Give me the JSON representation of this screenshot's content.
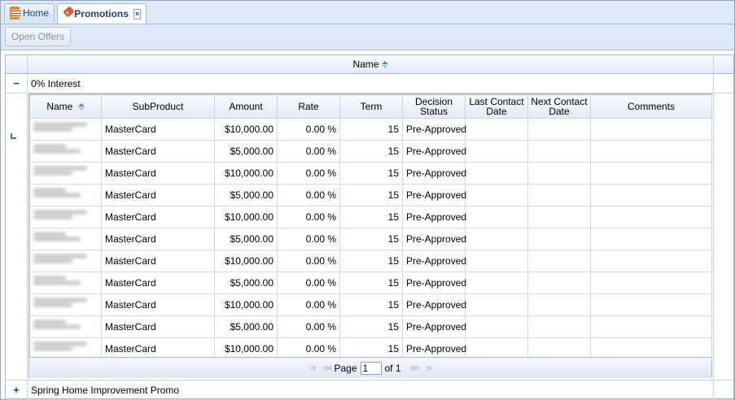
{
  "tabs": [
    {
      "label": "Home",
      "icon": "calendar-icon"
    },
    {
      "label": "Promotions",
      "icon": "tag-icon",
      "close": "×"
    }
  ],
  "toolbar": {
    "open_offers": "Open Offers"
  },
  "outer_grid": {
    "header": "Name",
    "groups": [
      {
        "toggle": "−",
        "label": "0% Interest",
        "expanded": true
      },
      {
        "toggle": "+",
        "label": "Spring Home Improvement Promo",
        "expanded": false
      }
    ]
  },
  "inner_grid": {
    "columns": [
      "Name",
      "SubProduct",
      "Amount",
      "Rate",
      "Term",
      "Decision Status",
      "Last Contact Date",
      "Next Contact Date",
      "Comments"
    ],
    "rows": [
      {
        "subproduct": "MasterCard",
        "amount": "$10,000.00",
        "rate": "0.00 %",
        "term": "15",
        "status": "Pre-Approved"
      },
      {
        "subproduct": "MasterCard",
        "amount": "$5,000.00",
        "rate": "0.00 %",
        "term": "15",
        "status": "Pre-Approved"
      },
      {
        "subproduct": "MasterCard",
        "amount": "$10,000.00",
        "rate": "0.00 %",
        "term": "15",
        "status": "Pre-Approved"
      },
      {
        "subproduct": "MasterCard",
        "amount": "$5,000.00",
        "rate": "0.00 %",
        "term": "15",
        "status": "Pre-Approved"
      },
      {
        "subproduct": "MasterCard",
        "amount": "$10,000.00",
        "rate": "0.00 %",
        "term": "15",
        "status": "Pre-Approved"
      },
      {
        "subproduct": "MasterCard",
        "amount": "$5,000.00",
        "rate": "0.00 %",
        "term": "15",
        "status": "Pre-Approved"
      },
      {
        "subproduct": "MasterCard",
        "amount": "$10,000.00",
        "rate": "0.00 %",
        "term": "15",
        "status": "Pre-Approved"
      },
      {
        "subproduct": "MasterCard",
        "amount": "$5,000.00",
        "rate": "0.00 %",
        "term": "15",
        "status": "Pre-Approved"
      },
      {
        "subproduct": "MasterCard",
        "amount": "$10,000.00",
        "rate": "0.00 %",
        "term": "15",
        "status": "Pre-Approved"
      },
      {
        "subproduct": "MasterCard",
        "amount": "$5,000.00",
        "rate": "0.00 %",
        "term": "15",
        "status": "Pre-Approved"
      },
      {
        "subproduct": "MasterCard",
        "amount": "$10,000.00",
        "rate": "0.00 %",
        "term": "15",
        "status": "Pre-Approved"
      }
    ],
    "pager": {
      "page_label": "Page",
      "page_value": "1",
      "of_label": "of 1"
    }
  }
}
